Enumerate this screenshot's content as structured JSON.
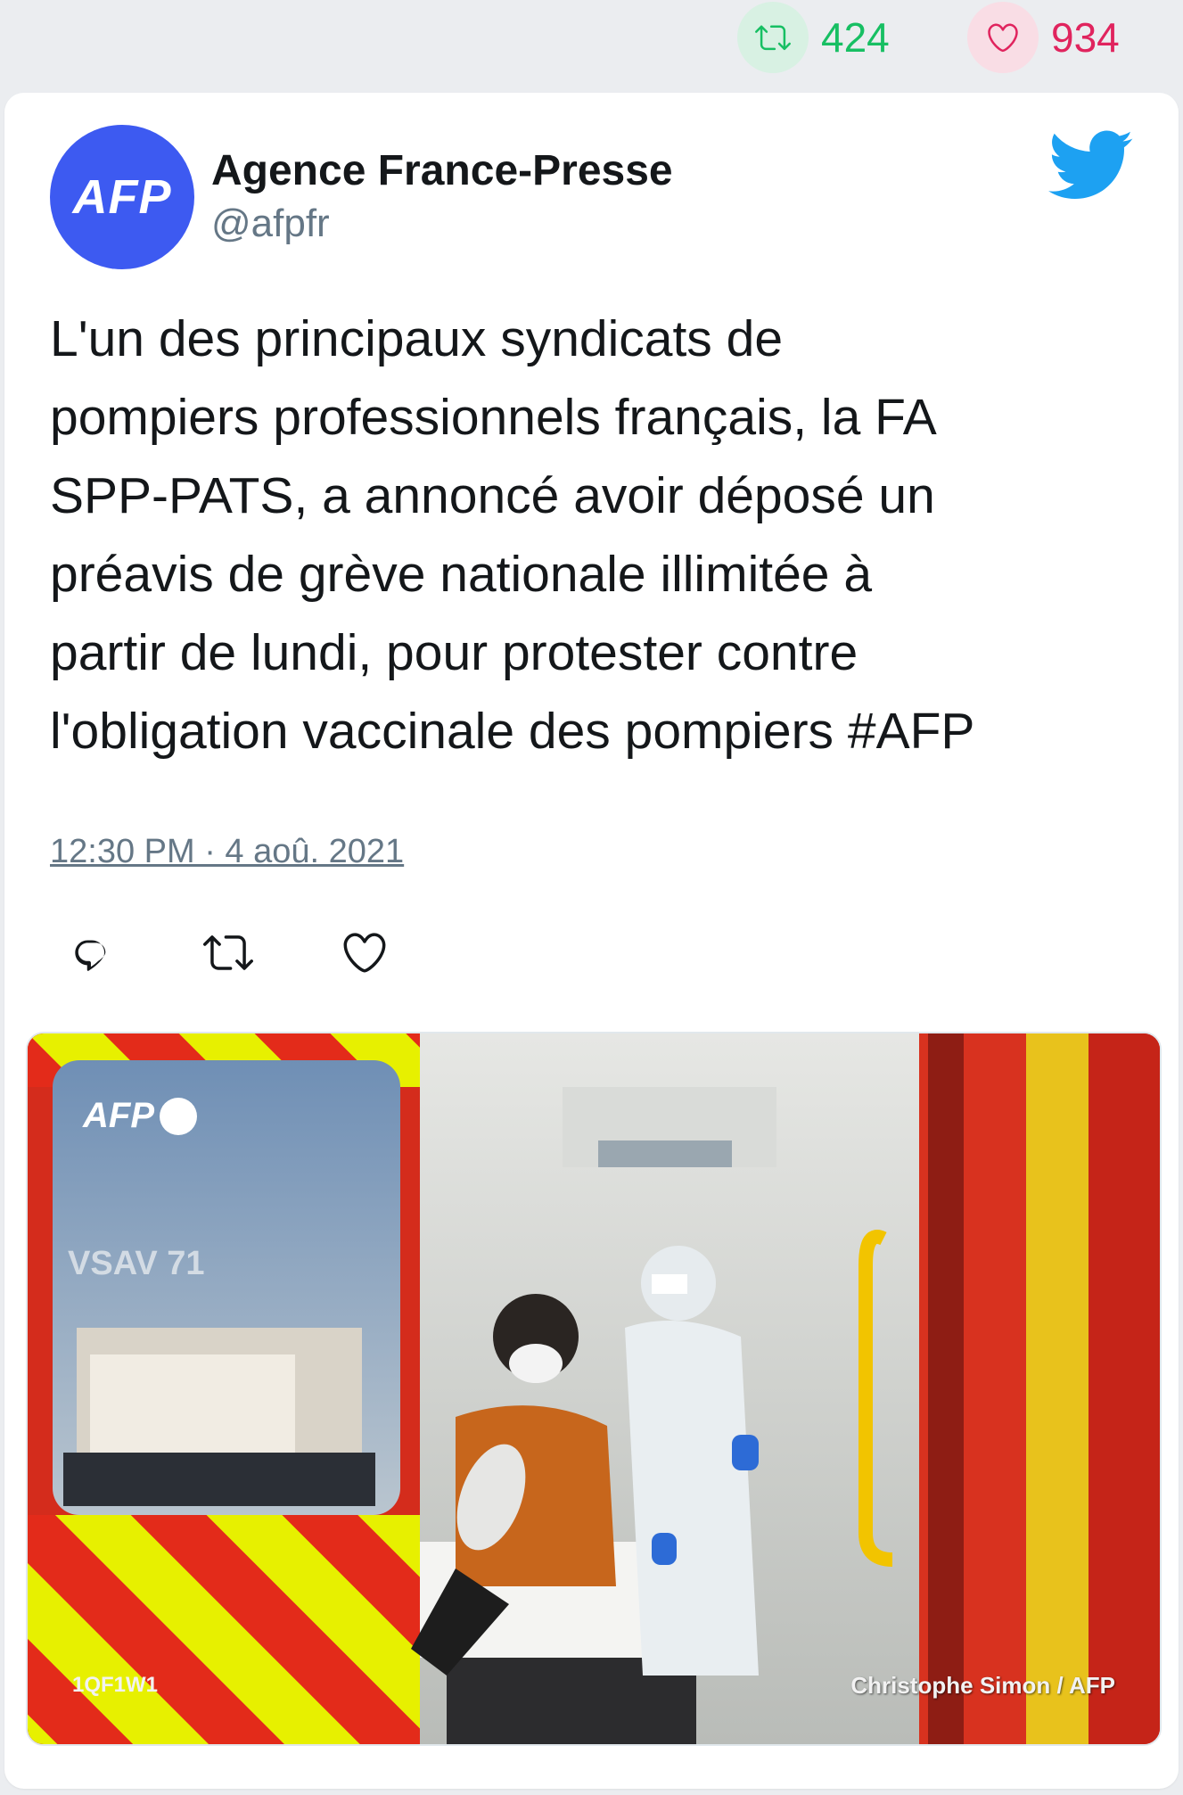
{
  "stats": {
    "retweets": "424",
    "likes": "934"
  },
  "tweet": {
    "author_name": "Agence France-Presse",
    "author_handle": "@afpfr",
    "avatar_text": "AFP",
    "text": "L'un des principaux syndicats de\npompiers professionnels français, la FA\nSPP-PATS, a annoncé avoir déposé un\npréavis de grève nationale illimitée à\npartir de lundi, pour protester contre\nl'obligation vaccinale des pompiers #AFP",
    "timestamp": "12:30 PM · 4 aoû. 2021"
  },
  "actions": [
    {
      "icon": "reply-icon"
    },
    {
      "icon": "retweet-icon"
    },
    {
      "icon": "like-icon"
    }
  ],
  "photo": {
    "watermark": "AFP",
    "credit": "Christophe Simon / AFP",
    "plate": "1QF1W1"
  },
  "colors": {
    "retweet": "#17bf63",
    "like": "#e0245e",
    "twitter_blue": "#1da1f2",
    "afp_blue": "#3d5af1",
    "text": "#14171a",
    "muted": "#657786"
  }
}
